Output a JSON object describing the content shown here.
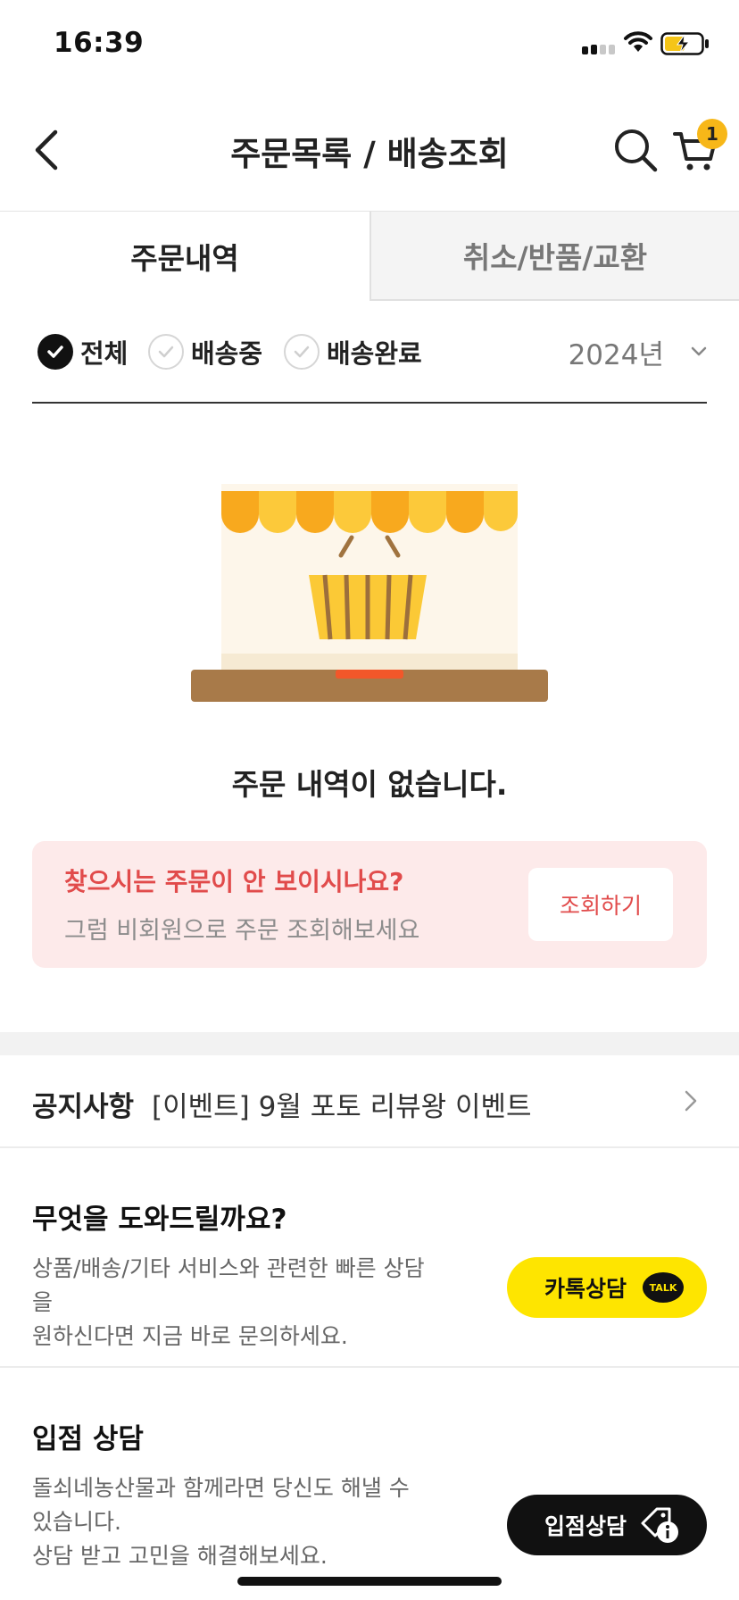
{
  "status_bar": {
    "time": "16:39"
  },
  "header": {
    "title": "주문목록 / 배송조회",
    "cart_count": "1"
  },
  "tabs": [
    {
      "label": "주문내역",
      "active": true
    },
    {
      "label": "취소/반품/교환",
      "active": false
    }
  ],
  "filters": {
    "options": [
      {
        "label": "전체",
        "checked": true
      },
      {
        "label": "배송중",
        "checked": false
      },
      {
        "label": "배송완료",
        "checked": false
      }
    ],
    "year": "2024년"
  },
  "empty_state": {
    "message": "주문 내역이 없습니다."
  },
  "guest_lookup": {
    "title": "찾으시는 주문이 안 보이시나요?",
    "subtitle": "그럼 비회원으로 주문 조회해보세요",
    "button": "조회하기"
  },
  "notice": {
    "label": "공지사항",
    "text": "[이벤트] 9월 포토 리뷰왕 이벤트"
  },
  "help": {
    "title": "무엇을 도와드릴까요?",
    "desc_line1": "상품/배송/기타 서비스와 관련한 빠른 상담을",
    "desc_line2": "원하신다면 지금 바로 문의하세요.",
    "button": "카톡상담",
    "talk_badge": "TALK"
  },
  "store_consult": {
    "title": "입점 상담",
    "desc_line1": "돌쇠네농산물과 함께라면 당신도 해낼 수",
    "desc_line2": "있습니다.",
    "desc_line3": "상담 받고 고민을 해결해보세요.",
    "button": "입점상담"
  },
  "colors": {
    "accent_red": "#e14b4b",
    "guest_bg": "#fdeaea",
    "kakao_yellow": "#fee500",
    "badge_yellow": "#f7b718"
  }
}
